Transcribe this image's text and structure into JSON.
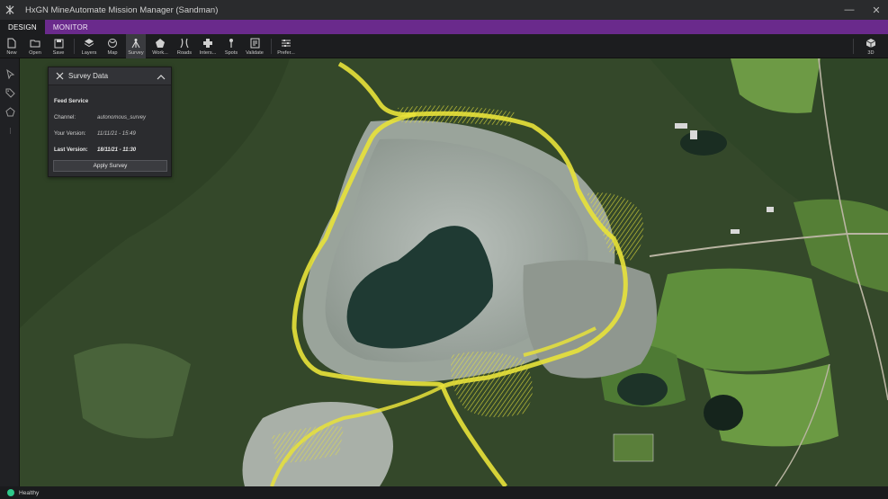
{
  "window": {
    "title": "HxGN MineAutomate Mission Manager (Sandman)",
    "minimize_glyph": "—",
    "close_glyph": "✕"
  },
  "tabs": [
    {
      "label": "DESIGN",
      "active": true
    },
    {
      "label": "MONITOR",
      "active": false
    }
  ],
  "toolbar": {
    "items": [
      {
        "label": "New",
        "icon": "new-file-icon"
      },
      {
        "label": "Open",
        "icon": "folder-icon"
      },
      {
        "label": "Save",
        "icon": "save-icon"
      },
      {
        "label": "Layers",
        "icon": "layers-icon"
      },
      {
        "label": "Map",
        "icon": "map-icon"
      },
      {
        "label": "Survey",
        "icon": "survey-icon",
        "active": true
      },
      {
        "label": "Work...",
        "icon": "work-area-icon"
      },
      {
        "label": "Roads",
        "icon": "roads-icon"
      },
      {
        "label": "Inters...",
        "icon": "intersection-icon"
      },
      {
        "label": "Spots",
        "icon": "spots-icon"
      },
      {
        "label": "Validate",
        "icon": "validate-icon"
      },
      {
        "label": "Prefer...",
        "icon": "preferences-icon"
      }
    ],
    "view_toggle": {
      "label": "3D",
      "icon": "cube-icon"
    }
  },
  "left_rail": [
    "select-arrow-icon",
    "tag-icon",
    "polygon-icon"
  ],
  "survey_panel": {
    "title": "Survey Data",
    "section": "Feed Service",
    "channel_label": "Channel:",
    "channel_value": "autonomous_survey",
    "your_version_label": "Your Version:",
    "your_version_value": "11/11/21 - 15:49",
    "last_version_label": "Last Version:",
    "last_version_value": "18/11/21 - 11:30",
    "apply_button": "Apply Survey"
  },
  "status": {
    "text": "Healthy",
    "color": "#2ec88a"
  },
  "colors": {
    "accent_purple": "#6a2a8c",
    "road_yellow": "#e8e23a"
  }
}
